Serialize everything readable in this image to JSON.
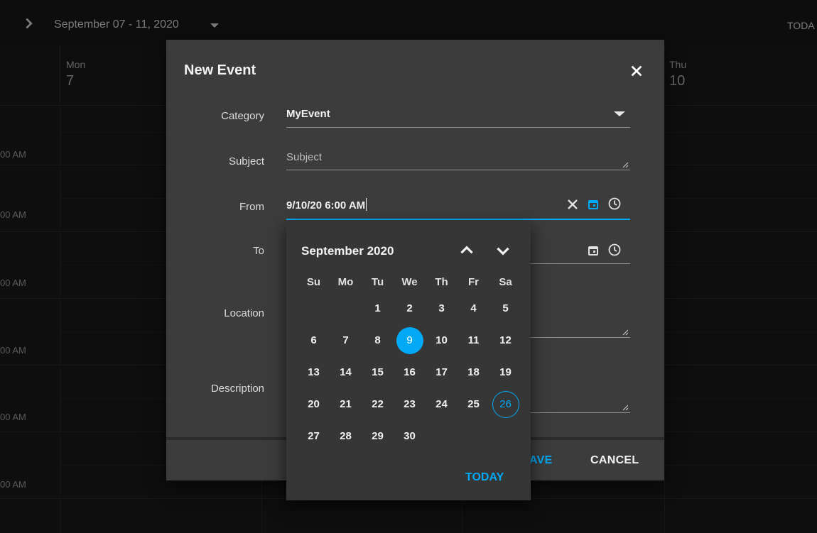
{
  "toolbar": {
    "date_range": "September 07 - 11, 2020",
    "today_label": "TODA"
  },
  "schedule": {
    "days": [
      {
        "name": "Mon",
        "num": "7"
      },
      {
        "name": "Thu",
        "num": "10"
      }
    ],
    "time_labels": [
      "00 AM",
      "00 AM",
      "00 AM",
      "00 AM",
      "00 AM",
      "00 AM"
    ]
  },
  "dialog": {
    "title": "New Event",
    "fields": {
      "category": {
        "label": "Category",
        "value": "MyEvent"
      },
      "subject": {
        "label": "Subject",
        "placeholder": "Subject"
      },
      "from": {
        "label": "From",
        "value": "9/10/20 6:00 AM"
      },
      "to": {
        "label": "To"
      },
      "location": {
        "label": "Location"
      },
      "description": {
        "label": "Description"
      }
    },
    "buttons": {
      "save": "SAVE",
      "cancel": "CANCEL"
    }
  },
  "calendar": {
    "title": "September 2020",
    "weekdays": [
      "Su",
      "Mo",
      "Tu",
      "We",
      "Th",
      "Fr",
      "Sa"
    ],
    "weeks": [
      [
        "",
        "",
        "1",
        "2",
        "3",
        "4",
        "5"
      ],
      [
        "6",
        "7",
        "8",
        "9",
        "10",
        "11",
        "12"
      ],
      [
        "13",
        "14",
        "15",
        "16",
        "17",
        "18",
        "19"
      ],
      [
        "20",
        "21",
        "22",
        "23",
        "24",
        "25",
        "26"
      ],
      [
        "27",
        "28",
        "29",
        "30",
        "",
        "",
        ""
      ]
    ],
    "selected_day": "9",
    "today_day": "26",
    "today_button": "TODAY"
  },
  "colors": {
    "accent": "#03a9f4",
    "dialog_bg": "#3c3c3c",
    "popup_bg": "#363636",
    "app_bg": "#161616"
  },
  "icons": [
    "chevron-right-icon",
    "caret-down-icon",
    "close-icon",
    "clear-icon",
    "calendar-icon",
    "clock-icon",
    "chevron-up-icon",
    "chevron-down-icon",
    "resize-handle-icon"
  ]
}
